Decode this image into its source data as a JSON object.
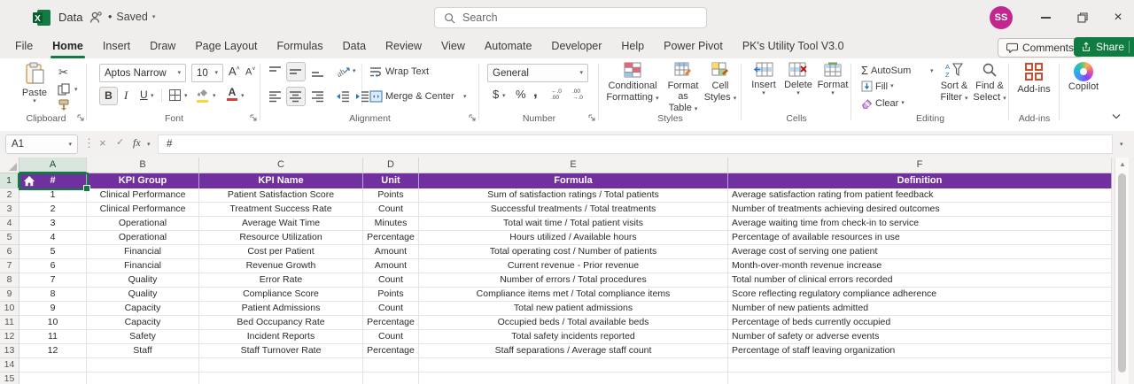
{
  "titlebar": {
    "app_title": "Data",
    "saved_bullet": "•",
    "saved_status": "Saved",
    "search_placeholder": "Search",
    "avatar_initials": "SS"
  },
  "ribbon_tabs": {
    "tabs": [
      "File",
      "Home",
      "Insert",
      "Draw",
      "Page Layout",
      "Formulas",
      "Data",
      "Review",
      "View",
      "Automate",
      "Developer",
      "Help",
      "Power Pivot",
      "PK's Utility Tool V3.0"
    ],
    "active": "Home",
    "comments": "Comments",
    "share": "Share"
  },
  "ribbon": {
    "clipboard": {
      "label": "Clipboard",
      "paste": "Paste"
    },
    "font": {
      "label": "Font",
      "family": "Aptos Narrow",
      "size": "10",
      "bold": "B",
      "italic": "I",
      "underline": "U",
      "grow": "A",
      "shrink": "A"
    },
    "alignment": {
      "label": "Alignment",
      "wrap": "Wrap Text",
      "merge": "Merge & Center"
    },
    "number": {
      "label": "Number",
      "format": "General",
      "currency": "$",
      "percent": "%",
      "comma": ","
    },
    "styles": {
      "label": "Styles",
      "conditional": [
        "Conditional",
        "Formatting"
      ],
      "format_table": [
        "Format as",
        "Table"
      ],
      "cell_styles": [
        "Cell",
        "Styles"
      ]
    },
    "cells": {
      "label": "Cells",
      "insert": "Insert",
      "delete": "Delete",
      "format": "Format"
    },
    "editing": {
      "label": "Editing",
      "autosum": "AutoSum",
      "fill": "Fill",
      "clear": "Clear",
      "sigma": "Σ",
      "sort": [
        "Sort &",
        "Filter"
      ],
      "find": [
        "Find &",
        "Select"
      ]
    },
    "addins": {
      "label": "Add-ins",
      "button": "Add-ins",
      "copilot": "Copilot"
    }
  },
  "formula_bar": {
    "name_box": "A1",
    "fx": "fx",
    "value": "#"
  },
  "sheet": {
    "columns": [
      "A",
      "B",
      "C",
      "D",
      "E",
      "F"
    ],
    "row_numbers": [
      "1",
      "2",
      "3",
      "4",
      "5",
      "6",
      "7",
      "8",
      "9",
      "10",
      "11",
      "12",
      "13",
      "14",
      "15"
    ],
    "header": [
      "#",
      "KPI Group",
      "KPI Name",
      "Unit",
      "Formula",
      "Definition"
    ],
    "rows": [
      {
        "cells": [
          "1",
          "Clinical Performance",
          "Patient Satisfaction Score",
          "Points",
          "Sum of satisfaction ratings / Total patients",
          "Average satisfaction rating from patient feedback"
        ]
      },
      {
        "cells": [
          "2",
          "Clinical Performance",
          "Treatment Success Rate",
          "Count",
          "Successful treatments / Total treatments",
          "Number of treatments achieving desired outcomes"
        ]
      },
      {
        "cells": [
          "3",
          "Operational",
          "Average Wait Time",
          "Minutes",
          "Total wait time / Total patient visits",
          "Average waiting time from check-in to service"
        ]
      },
      {
        "cells": [
          "4",
          "Operational",
          "Resource Utilization",
          "Percentage",
          "Hours utilized / Available hours",
          "Percentage of available resources in use"
        ]
      },
      {
        "cells": [
          "5",
          "Financial",
          "Cost per Patient",
          "Amount",
          "Total operating cost / Number of patients",
          "Average cost of serving one patient"
        ]
      },
      {
        "cells": [
          "6",
          "Financial",
          "Revenue Growth",
          "Amount",
          "Current revenue - Prior revenue",
          "Month-over-month revenue increase"
        ]
      },
      {
        "cells": [
          "7",
          "Quality",
          "Error Rate",
          "Count",
          "Number of errors / Total procedures",
          "Total number of clinical errors recorded"
        ]
      },
      {
        "cells": [
          "8",
          "Quality",
          "Compliance Score",
          "Points",
          "Compliance items met / Total compliance items",
          "Score reflecting regulatory compliance adherence"
        ]
      },
      {
        "cells": [
          "9",
          "Capacity",
          "Patient Admissions",
          "Count",
          "Total new patient admissions",
          "Number of new patients admitted"
        ]
      },
      {
        "cells": [
          "10",
          "Capacity",
          "Bed Occupancy Rate",
          "Percentage",
          "Occupied beds / Total available beds",
          "Percentage of beds currently occupied"
        ]
      },
      {
        "cells": [
          "11",
          "Safety",
          "Incident Reports",
          "Count",
          "Total safety incidents reported",
          "Number of safety or adverse events"
        ]
      },
      {
        "cells": [
          "12",
          "Staff",
          "Staff Turnover Rate",
          "Percentage",
          "Staff separations / Average staff count",
          "Percentage of staff leaving organization"
        ]
      }
    ]
  },
  "colors": {
    "header_fill": "#7030A0",
    "selection_green": "#107C41",
    "share_green": "#107C41",
    "avatar_pink": "#C3268F",
    "addins_orange": "#CB4E2E"
  }
}
